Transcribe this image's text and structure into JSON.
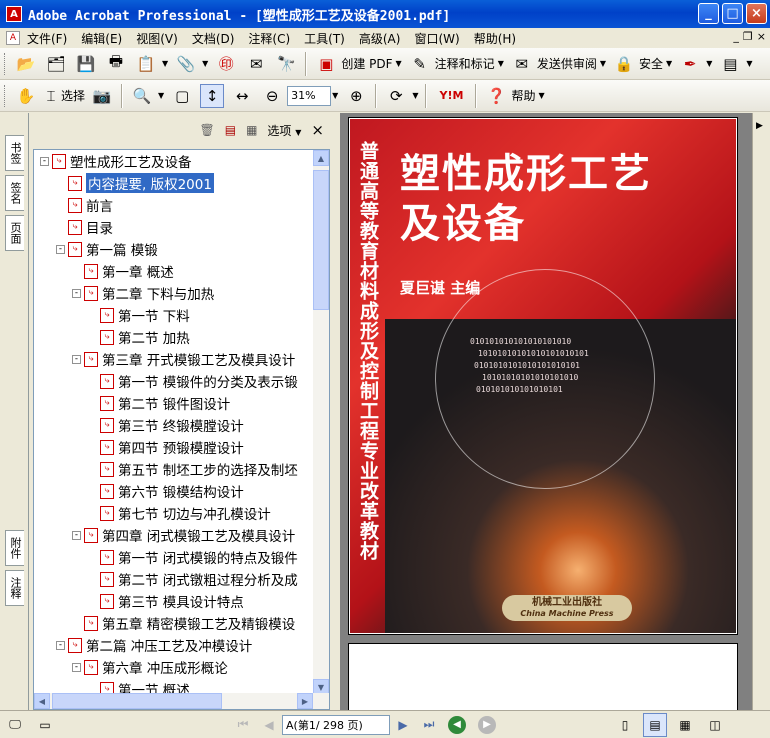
{
  "window": {
    "title": "Adobe Acrobat Professional - [塑性成形工艺及设备2001.pdf]",
    "app_icon": "acrobat-icon",
    "controls": [
      "_",
      "□",
      "×"
    ]
  },
  "menu": {
    "items": [
      "文件(F)",
      "编辑(E)",
      "视图(V)",
      "文档(D)",
      "注释(C)",
      "工具(T)",
      "高级(A)",
      "窗口(W)",
      "帮助(H)"
    ],
    "mdi_controls": [
      "_",
      "❐",
      "×"
    ]
  },
  "toolbar1": {
    "create_pdf": "创建 PDF",
    "comment_markup": "注释和标记",
    "send_review": "发送供审阅",
    "security": "安全"
  },
  "toolbar2": {
    "select": "选择",
    "zoom": "31%",
    "help": "帮助"
  },
  "nav_tabs": {
    "bookmarks": "书签",
    "signatures": "签名",
    "pages": "页面",
    "attachments": "附件",
    "comments": "注释"
  },
  "bookmark_panel": {
    "options": "选项",
    "close": "×",
    "items": [
      {
        "label": "塑性成形工艺及设备",
        "level": 0,
        "expander": "-"
      },
      {
        "label": "内容提要, 版权2001",
        "level": 1,
        "expander": "",
        "selected": true
      },
      {
        "label": "前言",
        "level": 1,
        "expander": ""
      },
      {
        "label": "目录",
        "level": 1,
        "expander": ""
      },
      {
        "label": "第一篇 模锻",
        "level": 1,
        "expander": "-"
      },
      {
        "label": "第一章 概述",
        "level": 2,
        "expander": ""
      },
      {
        "label": "第二章 下料与加热",
        "level": 2,
        "expander": "-"
      },
      {
        "label": "第一节 下料",
        "level": 3,
        "expander": ""
      },
      {
        "label": "第二节 加热",
        "level": 3,
        "expander": ""
      },
      {
        "label": "第三章 开式模锻工艺及模具设计",
        "level": 2,
        "expander": "-"
      },
      {
        "label": "第一节 模锻件的分类及表示锻",
        "level": 3,
        "expander": ""
      },
      {
        "label": "第二节 锻件图设计",
        "level": 3,
        "expander": ""
      },
      {
        "label": "第三节 终锻模膛设计",
        "level": 3,
        "expander": ""
      },
      {
        "label": "第四节 预锻模膛设计",
        "level": 3,
        "expander": ""
      },
      {
        "label": "第五节 制坯工步的选择及制坯",
        "level": 3,
        "expander": ""
      },
      {
        "label": "第六节 锻模结构设计",
        "level": 3,
        "expander": ""
      },
      {
        "label": "第七节 切边与冲孔模设计",
        "level": 3,
        "expander": ""
      },
      {
        "label": "第四章 闭式模锻工艺及模具设计",
        "level": 2,
        "expander": "-"
      },
      {
        "label": "第一节 闭式模锻的特点及锻件",
        "level": 3,
        "expander": ""
      },
      {
        "label": "第二节 闭式镦粗过程分析及成",
        "level": 3,
        "expander": ""
      },
      {
        "label": "第三节 模具设计特点",
        "level": 3,
        "expander": ""
      },
      {
        "label": "第五章 精密模锻工艺及精锻模设",
        "level": 2,
        "expander": ""
      },
      {
        "label": "第二篇 冲压工艺及冲模设计",
        "level": 1,
        "expander": "-"
      },
      {
        "label": "第六章 冲压成形概论",
        "level": 2,
        "expander": "-"
      },
      {
        "label": "第一节 概述",
        "level": 3,
        "expander": ""
      }
    ]
  },
  "cover": {
    "vertical_text": "普通高等教育材料成形及控制工程专业改革教材",
    "title_line1": "塑性成形工艺",
    "title_line2": "及设备",
    "editor": "夏巨谌  主编",
    "binary_lines": [
      "010101010101010101010",
      "10101010101010101010101",
      "0101010101010101010101",
      "10101010101010101010",
      "010101010101010101"
    ],
    "publisher_cn": "机械工业出版社",
    "publisher_en": "China Machine Press"
  },
  "status": {
    "page_display": "A(第1/ 298 页)"
  },
  "colors": {
    "titlebar": "#0041c8",
    "cover_red": "#d42a2a",
    "selection": "#316ac5"
  }
}
